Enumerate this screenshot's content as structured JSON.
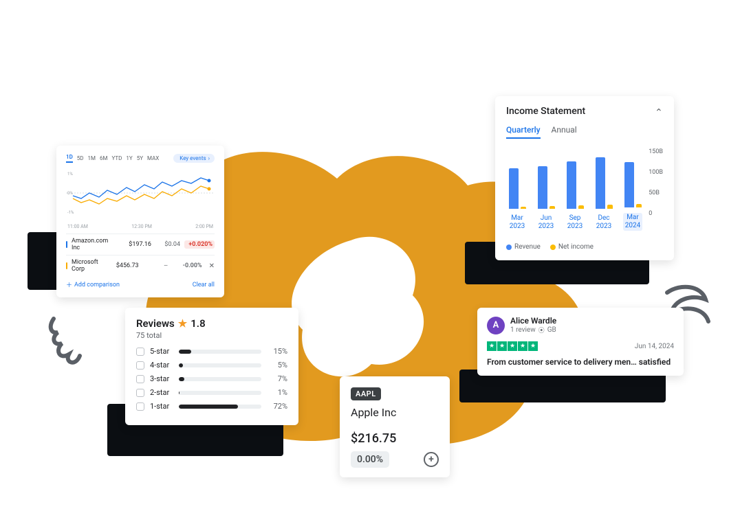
{
  "stock_compare": {
    "ranges": [
      "1D",
      "5D",
      "1M",
      "6M",
      "YTD",
      "1Y",
      "5Y",
      "MAX"
    ],
    "active_range": "1D",
    "key_events_label": "Key events",
    "times": [
      "11:00 AM",
      "12:30 PM",
      "2:00 PM"
    ],
    "rows": [
      {
        "name": "Amazon.com Inc",
        "price": "$197.16",
        "delta": "$0.04",
        "pct": "+0.020%",
        "color": "blue",
        "close": false
      },
      {
        "name": "Microsoft Corp",
        "price": "$456.73",
        "delta": "--",
        "pct": "-0.00%",
        "color": "yellow",
        "close": true
      }
    ],
    "add_label": "Add comparison",
    "clear_label": "Clear all"
  },
  "income": {
    "title": "Income Statement",
    "tabs": [
      "Quarterly",
      "Annual"
    ],
    "active_tab": "Quarterly",
    "y_ticks": [
      "150B",
      "100B",
      "50B",
      "0"
    ],
    "legend": [
      {
        "label": "Revenue",
        "color": "blue"
      },
      {
        "label": "Net income",
        "color": "yellow"
      }
    ]
  },
  "chart_data": {
    "type": "bar",
    "title": "Income Statement",
    "ylabel": "",
    "ylim": [
      0,
      160
    ],
    "unit": "B",
    "categories": [
      "Mar 2023",
      "Jun 2023",
      "Sep 2023",
      "Dec 2023",
      "Mar 2024"
    ],
    "series": [
      {
        "name": "Revenue",
        "values": [
          95,
          100,
          110,
          120,
          105
        ]
      },
      {
        "name": "Net income",
        "values": [
          5,
          6,
          8,
          10,
          8
        ]
      }
    ]
  },
  "reviews": {
    "heading": "Reviews",
    "score": "1.8",
    "total": "75 total",
    "rows": [
      {
        "label": "5-star",
        "pct": "15%",
        "fill": 15
      },
      {
        "label": "4-star",
        "pct": "5%",
        "fill": 5
      },
      {
        "label": "3-star",
        "pct": "7%",
        "fill": 7
      },
      {
        "label": "2-star",
        "pct": "1%",
        "fill": 1
      },
      {
        "label": "1-star",
        "pct": "72%",
        "fill": 72
      }
    ]
  },
  "single_review": {
    "avatar_letter": "A",
    "name": "Alice Wardle",
    "sub_reviews": "1 review",
    "country": "GB",
    "date": "Jun 14, 2024",
    "title": "From customer service to delivery men… satisfied",
    "stars": 5
  },
  "quote": {
    "ticker": "AAPL",
    "company": "Apple Inc",
    "price": "$216.75",
    "pct": "0.00%"
  }
}
